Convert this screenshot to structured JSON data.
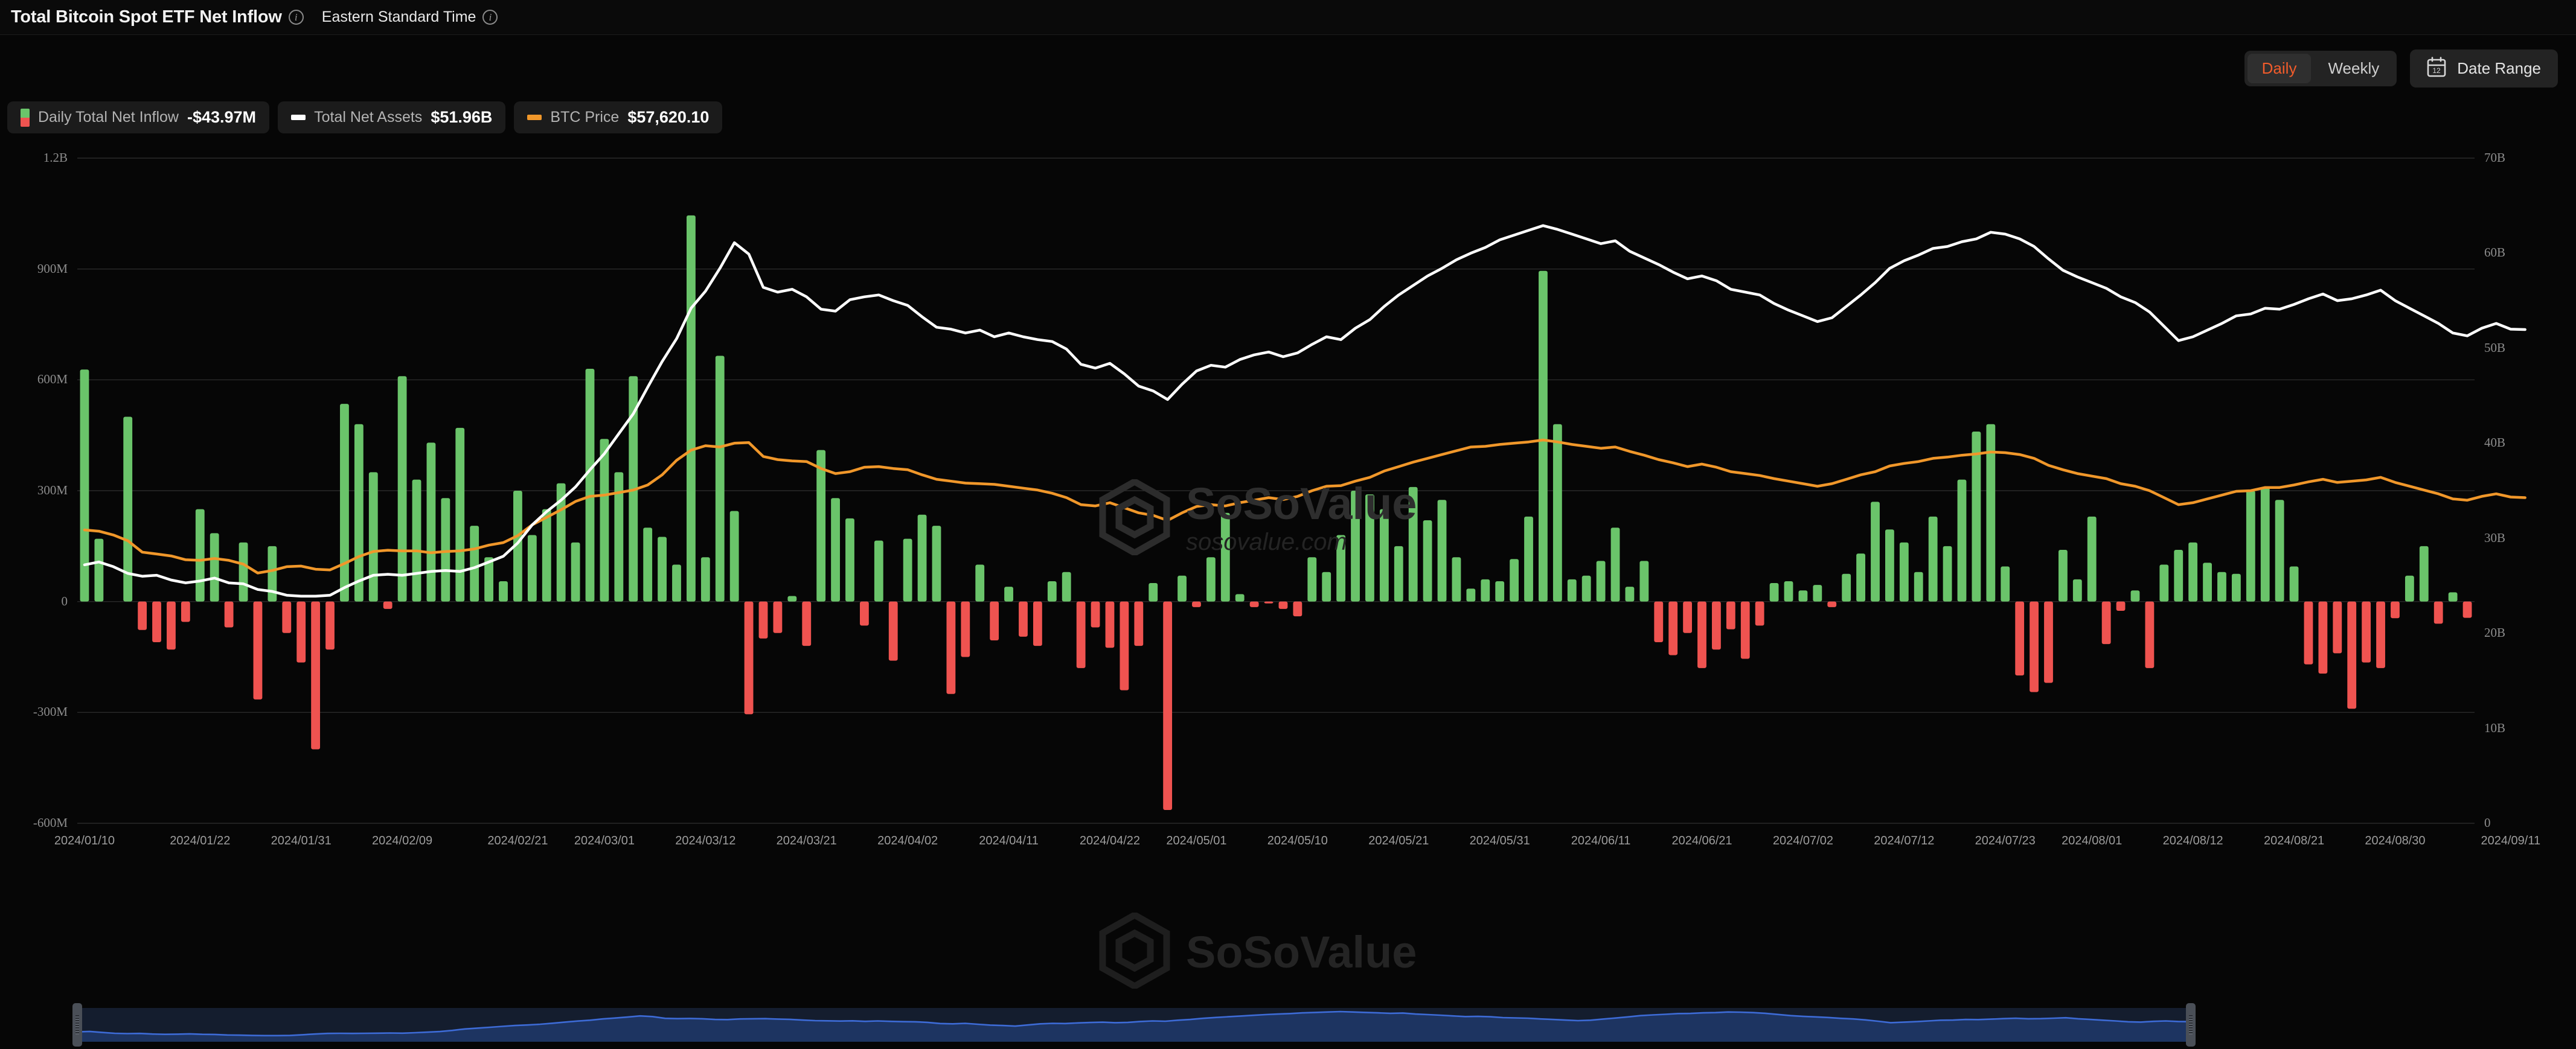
{
  "header": {
    "title": "Total Bitcoin Spot ETF Net Inflow",
    "timezone": "Eastern Standard Time",
    "info_icon": "info-icon"
  },
  "controls": {
    "interval_options": [
      "Daily",
      "Weekly"
    ],
    "interval_selected": "Daily",
    "date_range_label": "Date Range",
    "calendar_icon_day": "12"
  },
  "legend": [
    {
      "label": "Daily Total Net Inflow",
      "value": "-$43.97M",
      "color_up": "#6ac46a",
      "color_down": "#ef5350",
      "marker": "split-bar"
    },
    {
      "label": "Total Net Assets",
      "value": "$51.96B",
      "color": "#ffffff",
      "marker": "line"
    },
    {
      "label": "BTC Price",
      "value": "$57,620.10",
      "color": "#f0972a",
      "marker": "line"
    }
  ],
  "watermark": {
    "title": "SoSoValue",
    "subtitle": "sosovalue.com"
  },
  "colors": {
    "background": "#060606",
    "bar_positive": "#6ac46a",
    "bar_negative": "#ef5350",
    "line_assets": "#ffffff",
    "line_btc": "#f0972a",
    "grid": "#2a2a2a",
    "accent": "#f25c2b",
    "navigator_area": "#1d3461",
    "navigator_line": "#3d6bd6"
  },
  "chart_data": {
    "type": "bar",
    "title": "Total Bitcoin Spot ETF Net Inflow",
    "xlabel": "",
    "ylabel": "Daily Total Net Inflow",
    "y2label": "Total Net Assets / BTC Price",
    "ylim": [
      -600000000,
      1200000000
    ],
    "y_ticks": [
      "1.2B",
      "900M",
      "600M",
      "300M",
      "0",
      "-300M",
      "-600M"
    ],
    "y_tick_values": [
      1200000000,
      900000000,
      600000000,
      300000000,
      0,
      -300000000,
      -600000000
    ],
    "y2lim": [
      0,
      70000000000
    ],
    "y2_ticks": [
      "70B",
      "60B",
      "50B",
      "40B",
      "30B",
      "20B",
      "10B",
      "0"
    ],
    "y2_tick_values": [
      70000000000,
      60000000000,
      50000000000,
      40000000000,
      30000000000,
      20000000000,
      10000000000,
      0
    ],
    "grid": true,
    "legend_position": "top-left",
    "x_tick_labels": [
      "2024/01/10",
      "2024/01/22",
      "2024/01/31",
      "2024/02/09",
      "2024/02/21",
      "2024/03/01",
      "2024/03/12",
      "2024/03/21",
      "2024/04/02",
      "2024/04/11",
      "2024/04/22",
      "2024/05/01",
      "2024/05/10",
      "2024/05/21",
      "2024/05/31",
      "2024/06/11",
      "2024/06/21",
      "2024/07/02",
      "2024/07/12",
      "2024/07/23",
      "2024/08/01",
      "2024/08/12",
      "2024/08/21",
      "2024/08/30",
      "2024/09/11"
    ],
    "x_tick_indices": [
      0,
      8,
      15,
      22,
      30,
      36,
      43,
      50,
      57,
      64,
      71,
      77,
      84,
      91,
      98,
      105,
      112,
      119,
      126,
      133,
      139,
      146,
      153,
      160,
      168
    ],
    "series": [
      {
        "name": "Daily Total Net Inflow",
        "type": "bar",
        "axis": "left",
        "unit": "USD",
        "values": [
          628,
          170,
          0,
          500,
          -77,
          -110,
          -130,
          -55,
          250,
          185,
          -70,
          160,
          -265,
          150,
          -85,
          -165,
          -400,
          -130,
          535,
          480,
          350,
          -20,
          610,
          330,
          430,
          280,
          470,
          205,
          120,
          55,
          300,
          180,
          250,
          320,
          160,
          630,
          440,
          350,
          610,
          200,
          175,
          100,
          1045,
          120,
          665,
          245,
          -305,
          -100,
          -85,
          15,
          -120,
          410,
          280,
          225,
          -65,
          165,
          -160,
          170,
          235,
          205,
          -250,
          -150,
          100,
          -105,
          40,
          -95,
          -120,
          55,
          80,
          -180,
          -70,
          -125,
          -240,
          -120,
          50,
          -564,
          70,
          -15,
          120,
          240,
          20,
          -15,
          -5,
          -20,
          -40,
          120,
          80,
          180,
          300,
          290,
          250,
          150,
          310,
          220,
          275,
          120,
          35,
          60,
          55,
          115,
          230,
          895,
          480,
          60,
          70,
          110,
          200,
          40,
          110,
          -110,
          -145,
          -85,
          -180,
          -130,
          -75,
          -155,
          -65,
          50,
          55,
          30,
          45,
          -15,
          75,
          130,
          270,
          195,
          160,
          80,
          230,
          150,
          330,
          460,
          480,
          95,
          -200,
          -245,
          -220,
          140,
          60,
          230,
          -115,
          -25,
          30,
          -180,
          100,
          140,
          160,
          105,
          80,
          75,
          300,
          310,
          275,
          95,
          -170,
          -195,
          -140,
          -290,
          -165,
          -180,
          -45,
          70,
          150,
          -60,
          25,
          -44
        ]
      },
      {
        "name": "Total Net Assets",
        "type": "line",
        "axis": "right",
        "unit": "USD",
        "color": "#ffffff",
        "values": [
          27.2,
          27.5,
          27.0,
          26.3,
          26.0,
          26.1,
          25.6,
          25.3,
          25.5,
          25.8,
          25.3,
          25.2,
          24.6,
          24.4,
          24.0,
          23.9,
          23.9,
          24.0,
          24.8,
          25.5,
          26.1,
          26.2,
          26.1,
          26.3,
          26.5,
          26.6,
          26.5,
          26.9,
          27.5,
          28.1,
          29.5,
          31.4,
          32.8,
          34.0,
          35.4,
          37.2,
          38.9,
          41.0,
          43.1,
          45.9,
          48.6,
          51.0,
          54.2,
          56.0,
          58.4,
          61.1,
          59.9,
          56.4,
          55.9,
          56.2,
          55.4,
          54.1,
          53.9,
          55.1,
          55.4,
          55.6,
          55.0,
          54.5,
          53.3,
          52.2,
          52.0,
          51.6,
          51.9,
          51.2,
          51.6,
          51.2,
          50.9,
          50.7,
          49.9,
          48.3,
          47.9,
          48.4,
          47.3,
          46.0,
          45.5,
          44.6,
          46.2,
          47.6,
          48.2,
          48.0,
          48.8,
          49.3,
          49.6,
          49.1,
          49.5,
          50.4,
          51.2,
          50.9,
          52.1,
          53.0,
          54.4,
          55.6,
          56.6,
          57.6,
          58.4,
          59.3,
          60.0,
          60.6,
          61.4,
          61.9,
          62.4,
          62.9,
          62.5,
          62.0,
          61.5,
          61.0,
          61.3,
          60.2,
          59.5,
          58.8,
          58.0,
          57.3,
          57.6,
          57.1,
          56.2,
          55.9,
          55.6,
          54.7,
          54.0,
          53.4,
          52.8,
          53.2,
          54.4,
          55.6,
          56.9,
          58.4,
          59.2,
          59.8,
          60.5,
          60.7,
          61.2,
          61.5,
          62.2,
          62.0,
          61.5,
          60.7,
          59.4,
          58.2,
          57.5,
          56.9,
          56.3,
          55.4,
          54.8,
          53.8,
          52.3,
          50.8,
          51.2,
          51.9,
          52.6,
          53.4,
          53.6,
          54.2,
          54.1,
          54.6,
          55.2,
          55.7,
          55.0,
          55.2,
          55.6,
          56.1,
          55.0,
          54.2,
          53.4,
          52.6,
          51.6,
          51.3,
          52.1,
          52.6,
          52.0,
          51.96
        ]
      },
      {
        "name": "BTC Price",
        "type": "line",
        "axis": "right",
        "unit": "USD",
        "color": "#f0972a",
        "values": [
          46.3,
          46.1,
          45.5,
          44.6,
          42.8,
          42.5,
          42.2,
          41.6,
          41.5,
          41.8,
          41.5,
          40.9,
          39.5,
          39.9,
          40.5,
          40.6,
          40.1,
          40.0,
          41.0,
          42.1,
          42.9,
          43.1,
          43.0,
          43.0,
          42.7,
          42.9,
          43.0,
          43.3,
          43.9,
          44.3,
          45.4,
          47.1,
          48.3,
          49.5,
          50.8,
          51.6,
          51.8,
          52.2,
          52.6,
          53.4,
          55.0,
          57.3,
          58.9,
          59.6,
          59.4,
          60.0,
          60.1,
          57.9,
          57.4,
          57.2,
          57.1,
          56.0,
          55.2,
          55.5,
          56.2,
          56.3,
          56.0,
          55.8,
          55.0,
          54.3,
          54.0,
          53.7,
          53.6,
          53.5,
          53.2,
          52.9,
          52.6,
          52.1,
          51.4,
          50.3,
          50.1,
          50.6,
          49.8,
          49.0,
          48.6,
          47.8,
          49.0,
          50.0,
          50.3,
          50.1,
          50.6,
          51.0,
          51.4,
          51.1,
          51.6,
          52.5,
          53.2,
          53.3,
          54.0,
          54.6,
          55.6,
          56.3,
          57.0,
          57.6,
          58.2,
          58.8,
          59.4,
          59.5,
          59.8,
          60.0,
          60.2,
          60.5,
          60.2,
          59.8,
          59.5,
          59.2,
          59.4,
          58.7,
          58.1,
          57.4,
          56.9,
          56.3,
          56.7,
          56.2,
          55.5,
          55.2,
          54.9,
          54.4,
          54.0,
          53.6,
          53.2,
          53.6,
          54.3,
          55.0,
          55.5,
          56.4,
          56.8,
          57.1,
          57.6,
          57.8,
          58.1,
          58.3,
          58.6,
          58.5,
          58.2,
          57.6,
          56.5,
          55.8,
          55.2,
          54.8,
          54.4,
          53.6,
          53.2,
          52.5,
          51.4,
          50.3,
          50.6,
          51.2,
          51.8,
          52.4,
          52.5,
          53.0,
          53.0,
          53.4,
          53.9,
          54.3,
          53.8,
          54.0,
          54.2,
          54.6,
          53.8,
          53.2,
          52.6,
          52.0,
          51.2,
          51.0,
          51.6,
          52.0,
          51.5,
          51.4
        ]
      }
    ],
    "navigator": {
      "visible_range": "full",
      "values": [
        0.52,
        0.55,
        0.48,
        0.42,
        0.4,
        0.41,
        0.37,
        0.35,
        0.36,
        0.38,
        0.35,
        0.34,
        0.3,
        0.29,
        0.27,
        0.26,
        0.26,
        0.27,
        0.32,
        0.37,
        0.41,
        0.42,
        0.41,
        0.42,
        0.43,
        0.44,
        0.43,
        0.46,
        0.5,
        0.54,
        0.62,
        0.72,
        0.78,
        0.84,
        0.9,
        0.96,
        1.0,
        1.05,
        1.12,
        1.2,
        1.27,
        1.33,
        1.42,
        1.48,
        1.55,
        1.63,
        1.58,
        1.46,
        1.44,
        1.45,
        1.43,
        1.38,
        1.37,
        1.42,
        1.43,
        1.44,
        1.41,
        1.39,
        1.34,
        1.3,
        1.29,
        1.27,
        1.29,
        1.25,
        1.28,
        1.25,
        1.23,
        1.22,
        1.18,
        1.1,
        1.08,
        1.11,
        1.05,
        0.99,
        0.96,
        0.92,
        1.0,
        1.08,
        1.11,
        1.1,
        1.14,
        1.17,
        1.19,
        1.16,
        1.18,
        1.24,
        1.28,
        1.26,
        1.33,
        1.38,
        1.46,
        1.52,
        1.57,
        1.62,
        1.67,
        1.72,
        1.76,
        1.79,
        1.84,
        1.87,
        1.9,
        1.93,
        1.9,
        1.87,
        1.84,
        1.81,
        1.83,
        1.76,
        1.72,
        1.68,
        1.63,
        1.58,
        1.6,
        1.57,
        1.51,
        1.49,
        1.47,
        1.42,
        1.38,
        1.34,
        1.3,
        1.33,
        1.41,
        1.48,
        1.56,
        1.65,
        1.7,
        1.74,
        1.79,
        1.8,
        1.84,
        1.86,
        1.9,
        1.89,
        1.86,
        1.81,
        1.73,
        1.65,
        1.6,
        1.56,
        1.52,
        1.46,
        1.42,
        1.35,
        1.26,
        1.16,
        1.19,
        1.23,
        1.28,
        1.33,
        1.34,
        1.38,
        1.37,
        1.4,
        1.44,
        1.47,
        1.43,
        1.44,
        1.47,
        1.5,
        1.43,
        1.38,
        1.33,
        1.28,
        1.22,
        1.2,
        1.25,
        1.28,
        1.24,
        1.23
      ]
    }
  }
}
